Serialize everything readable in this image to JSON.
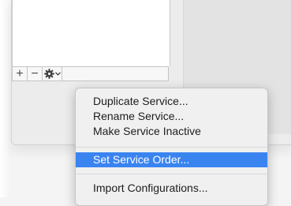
{
  "service_bar": {
    "add_glyph": "+",
    "remove_glyph": "−",
    "gear_icon": "gear-icon",
    "chevron_icon": "chevron-down-icon"
  },
  "menu": {
    "items": [
      {
        "label": "Duplicate Service..."
      },
      {
        "label": "Rename Service..."
      },
      {
        "label": "Make Service Inactive"
      },
      {
        "label": "Set Service Order..."
      },
      {
        "label": "Import Configurations..."
      }
    ],
    "selected_index": 3,
    "highlight_color": "#3a84f0"
  }
}
